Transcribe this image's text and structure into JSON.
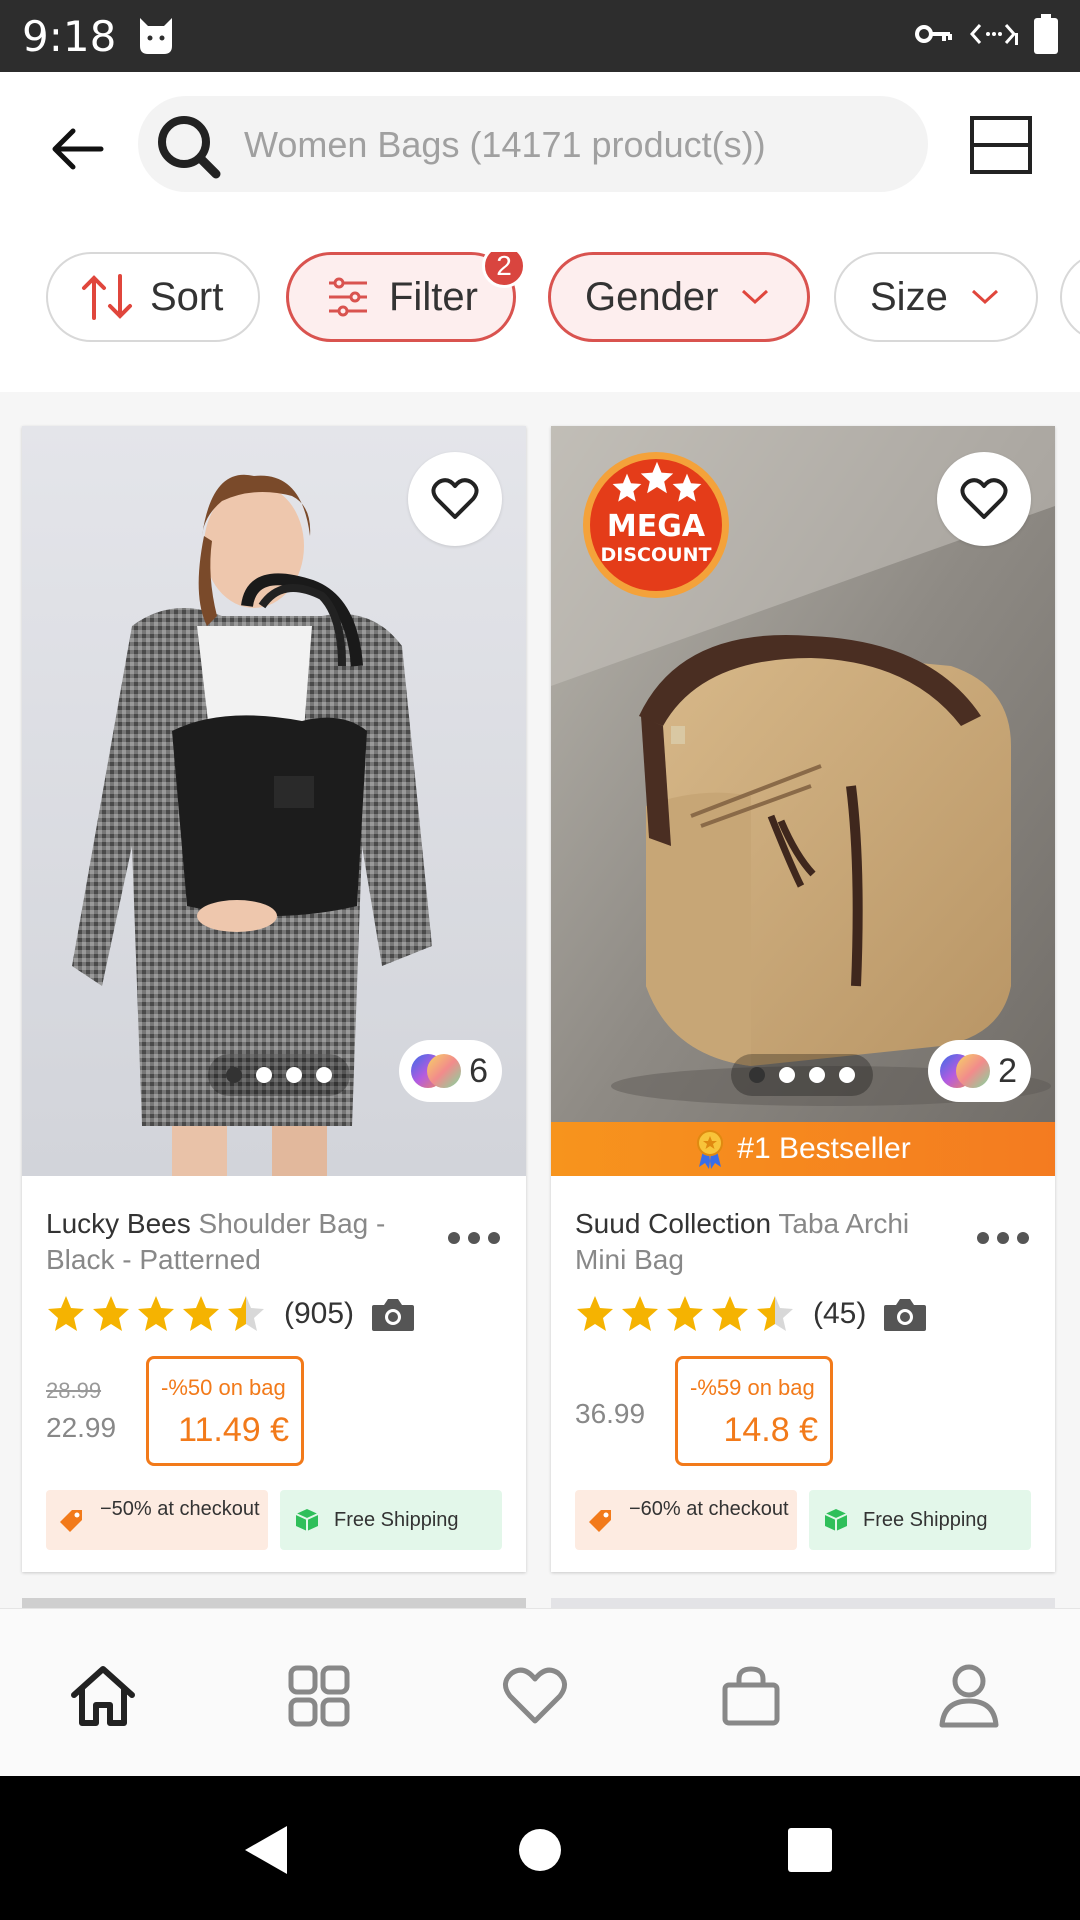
{
  "status_bar": {
    "time": "9:18",
    "icons": [
      "cat-icon",
      "vpn-key-icon",
      "data-saver-icon",
      "battery-icon"
    ]
  },
  "header": {
    "search_placeholder": "Women Bags (14171 product(s))",
    "icons": [
      "back-arrow-icon",
      "search-icon",
      "layout-toggle-icon"
    ]
  },
  "filter_chips": [
    {
      "label": "Sort",
      "icon": "sort-icon",
      "active": false
    },
    {
      "label": "Filter",
      "icon": "sliders-icon",
      "badge": "2",
      "active": true
    },
    {
      "label": "Gender",
      "icon": "chevron-down-icon",
      "active": true
    },
    {
      "label": "Size",
      "icon": "chevron-down-icon",
      "active": false
    }
  ],
  "products": [
    {
      "brand": "Lucky Bees",
      "name": "Shoulder Bag - Black - Patterned",
      "rating": 4.5,
      "review_count": "(905)",
      "color_count": "6",
      "old_price": "28.99",
      "price": "22.99",
      "discount_label": "-%50 on bag",
      "discount_price": "11.49 €",
      "checkout_tag": "−50% at checkout",
      "shipping_tag": "Free Shipping"
    },
    {
      "brand": "Suud Collection",
      "name": "Taba Archi Mini Bag",
      "rating": 4.5,
      "review_count": "(45)",
      "color_count": "2",
      "price": "36.99",
      "discount_label": "-%59 on bag",
      "discount_price": "14.8 €",
      "badge_line1": "MEGA",
      "badge_line2": "DISCOUNT",
      "bestseller": "#1 Bestseller",
      "checkout_tag": "−60% at checkout",
      "shipping_tag": "Free Shipping"
    }
  ],
  "bottom_nav": [
    "home-icon",
    "categories-icon",
    "favorites-icon",
    "cart-icon",
    "account-icon"
  ],
  "colors": {
    "accent": "#f27a1a",
    "active_chip_border": "#d9534f",
    "badge_red": "#d9453f",
    "star": "#f5b301",
    "shipping_green": "#2fbf5a"
  }
}
